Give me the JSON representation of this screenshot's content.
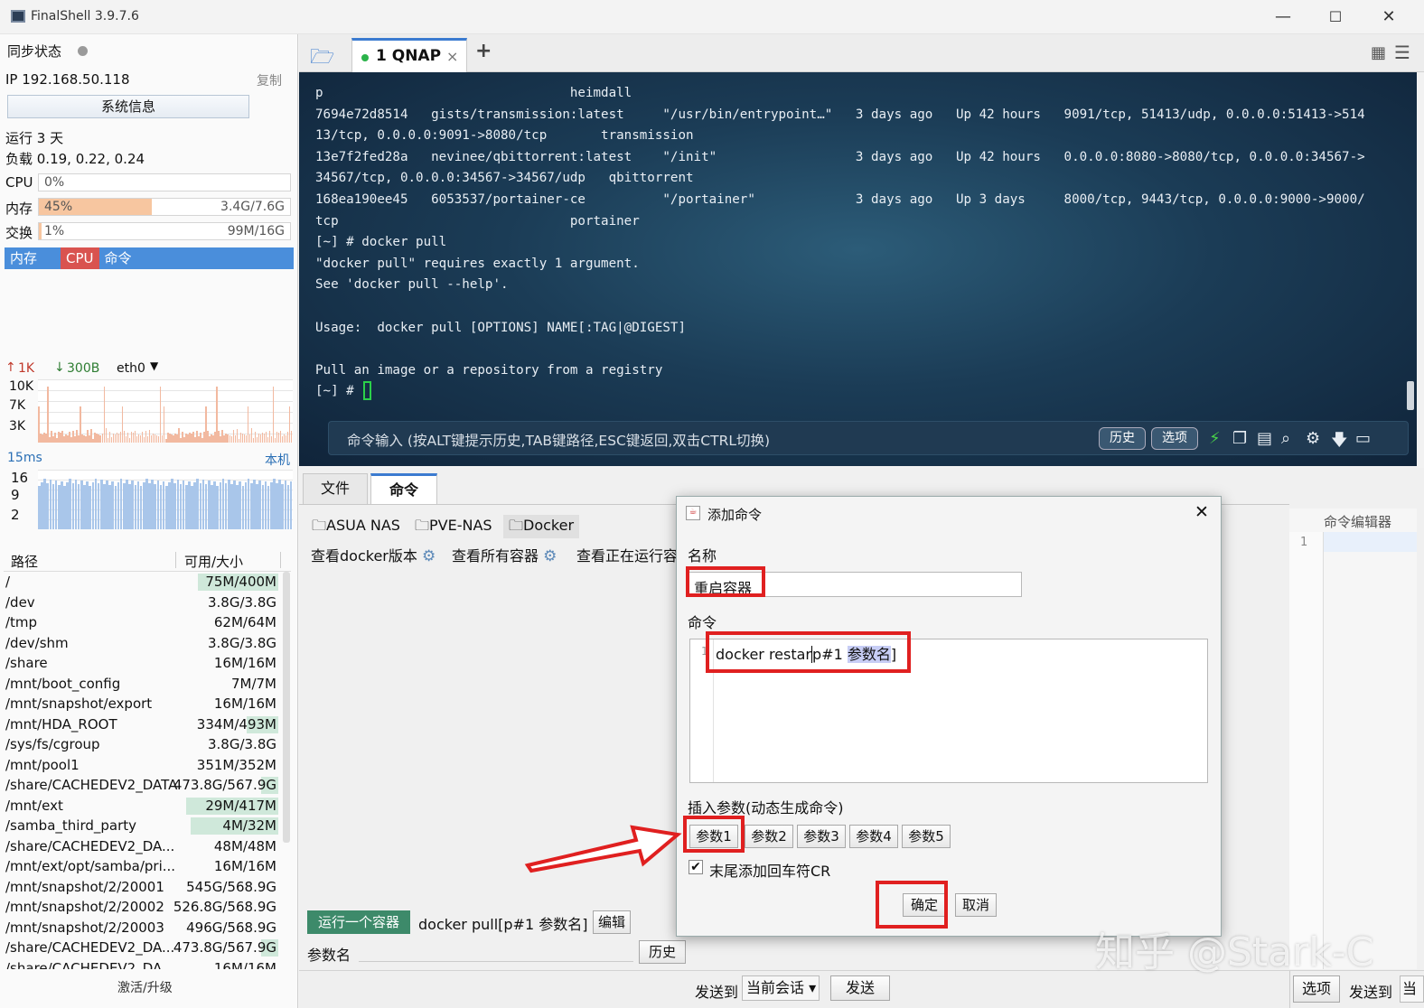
{
  "window": {
    "title": "FinalShell 3.9.7.6",
    "minimize": "—",
    "maximize": "☐",
    "close": "✕"
  },
  "left_panel": {
    "sync_label": "同步状态",
    "ip_label": "IP 192.168.50.118",
    "copy_label": "复制",
    "sysinfo_button": "系统信息",
    "uptime": "运行 3 天",
    "load": "负载 0.19, 0.22, 0.24",
    "cpu": {
      "label": "CPU",
      "value": "0%",
      "fraction": 0.0
    },
    "mem": {
      "label": "内存",
      "value": "45%",
      "detail": "3.4G/7.6G",
      "fraction": 0.45
    },
    "swap": {
      "label": "交换",
      "value": "1%",
      "detail": "99M/16G",
      "fraction": 0.01
    },
    "process_tabs": [
      "内存",
      "CPU",
      "命令"
    ],
    "net": {
      "up": "1K",
      "down": "300B",
      "iface": "eth0",
      "ticks": [
        "10K",
        "7K",
        "3K"
      ]
    },
    "latency": {
      "value": "15ms",
      "host": "本机",
      "ticks": [
        "16",
        "9",
        "2"
      ]
    },
    "disk_header": {
      "path": "路径",
      "size": "可用/大小"
    },
    "disks": [
      {
        "path": "/",
        "size": "75M/400M",
        "used": 0.81
      },
      {
        "path": "/dev",
        "size": "3.8G/3.8G",
        "used": 0.0
      },
      {
        "path": "/tmp",
        "size": "62M/64M",
        "used": 0.03
      },
      {
        "path": "/dev/shm",
        "size": "3.8G/3.8G",
        "used": 0.0
      },
      {
        "path": "/share",
        "size": "16M/16M",
        "used": 0.0
      },
      {
        "path": "/mnt/boot_config",
        "size": "7M/7M",
        "used": 0.0
      },
      {
        "path": "/mnt/snapshot/export",
        "size": "16M/16M",
        "used": 0.0
      },
      {
        "path": "/mnt/HDA_ROOT",
        "size": "334M/493M",
        "used": 0.32
      },
      {
        "path": "/sys/fs/cgroup",
        "size": "3.8G/3.8G",
        "used": 0.0
      },
      {
        "path": "/mnt/pool1",
        "size": "351M/352M",
        "used": 0.0
      },
      {
        "path": "/share/CACHEDEV2_DATA",
        "size": "473.8G/567.9G",
        "used": 0.17
      },
      {
        "path": "/mnt/ext",
        "size": "29M/417M",
        "used": 0.93
      },
      {
        "path": "/samba_third_party",
        "size": "4M/32M",
        "used": 0.88
      },
      {
        "path": "/share/CACHEDEV2_DA...",
        "size": "48M/48M",
        "used": 0.0
      },
      {
        "path": "/mnt/ext/opt/samba/pri...",
        "size": "16M/16M",
        "used": 0.0
      },
      {
        "path": "/mnt/snapshot/2/20001",
        "size": "545G/568.9G",
        "used": 0.04
      },
      {
        "path": "/mnt/snapshot/2/20002",
        "size": "526.8G/568.9G",
        "used": 0.07
      },
      {
        "path": "/mnt/snapshot/2/20003",
        "size": "496G/568.9G",
        "used": 0.13
      },
      {
        "path": "/share/CACHEDEV2_DA...",
        "size": "473.8G/567.9G",
        "used": 0.17
      },
      {
        "path": "/share/CACHEDEV2_DA",
        "size": "16M/16M",
        "used": 0.0
      }
    ],
    "activate": "激活/升级"
  },
  "session_tabs": {
    "active": "1 QNAP",
    "close": "×",
    "add": "+"
  },
  "terminal": {
    "lines": [
      "p                                heimdall",
      "7694e72d8514   gists/transmission:latest     \"/usr/bin/entrypoint…\"   3 days ago   Up 42 hours   9091/tcp, 51413/udp, 0.0.0.0:51413->514",
      "13/tcp, 0.0.0.0:9091->8080/tcp       transmission",
      "13e7f2fed28a   nevinee/qbittorrent:latest    \"/init\"                  3 days ago   Up 42 hours   0.0.0.0:8080->8080/tcp, 0.0.0.0:34567->",
      "34567/tcp, 0.0.0.0:34567->34567/udp   qbittorrent",
      "168ea190ee45   6053537/portainer-ce          \"/portainer\"             3 days ago   Up 3 days     8000/tcp, 9443/tcp, 0.0.0.0:9000->9000/",
      "tcp                              portainer",
      "[~] # docker pull",
      "\"docker pull\" requires exactly 1 argument.",
      "See 'docker pull --help'.",
      "",
      "Usage:  docker pull [OPTIONS] NAME[:TAG|@DIGEST]",
      "",
      "Pull an image or a repository from a registry",
      "[~] # "
    ],
    "cmd_placeholder": "命令输入 (按ALT键提示历史,TAB键路径,ESC键返回,双击CTRL切换)",
    "history_btn": "历史",
    "options_btn": "选项"
  },
  "bottom": {
    "tabs": [
      "文件",
      "命令"
    ],
    "folders": [
      "ASUA NAS",
      "PVE-NAS",
      "Docker"
    ],
    "commands": [
      "查看docker版本",
      "查看所有容器",
      "查看正在运行容"
    ],
    "run_container": "运行一个容器",
    "run_cmd": "docker pull[p#1 参数名]",
    "edit": "编辑",
    "param_label": "参数名",
    "history": "历史",
    "send_to": "发送到",
    "session_select": "当前会话",
    "send": "发送",
    "editor_title": "命令编辑器",
    "editor_line": "1",
    "options": "选项",
    "send_to2": "发送到",
    "cut": "当"
  },
  "dialog": {
    "title": "添加命令",
    "name_label": "名称",
    "name_value": "重启容器",
    "command_label": "命令",
    "line_no": "1",
    "command_prefix": "docker restar",
    "command_mid": "p#1 ",
    "command_param": "参数名",
    "command_end": "]",
    "insert_label": "插入参数(动态生成命令)",
    "params": [
      "参数1",
      "参数2",
      "参数3",
      "参数4",
      "参数5"
    ],
    "cr_label": "末尾添加回车符CR",
    "ok": "确定",
    "cancel": "取消"
  },
  "watermark": "知乎 @Stark-C",
  "colors": {
    "accent": "#4a8edb",
    "red": "#e02020",
    "green": "#2bb34a",
    "memfill": "#f7c6a0"
  }
}
